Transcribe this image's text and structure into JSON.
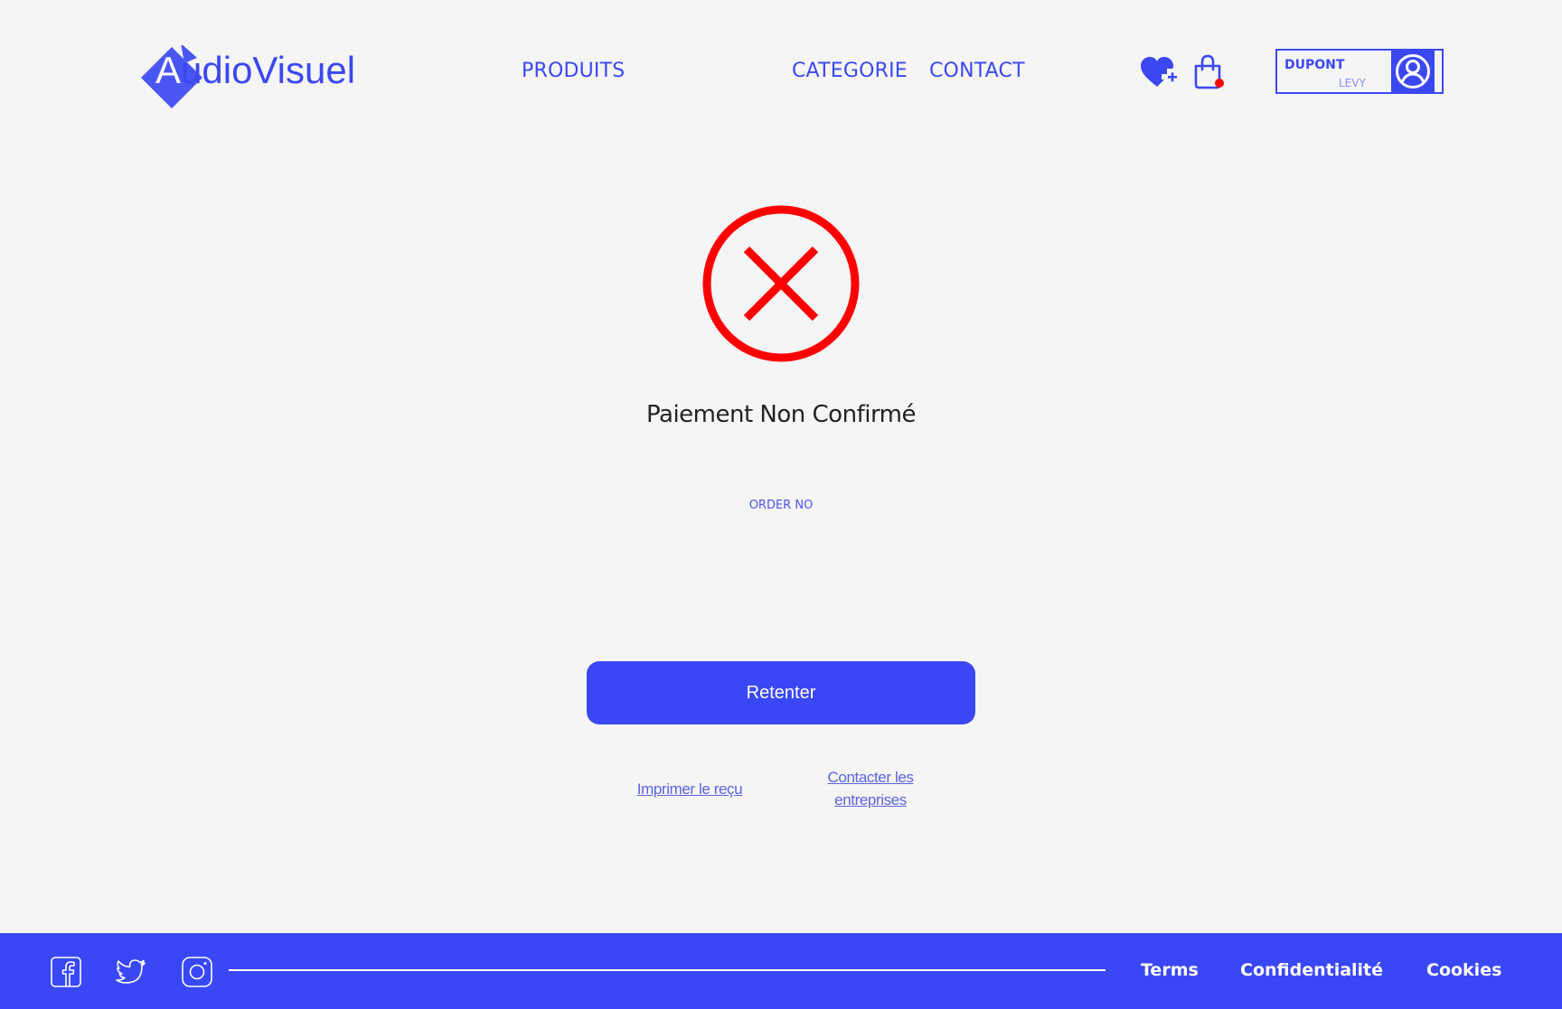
{
  "brand": {
    "logo_first_letter": "A",
    "logo_rest": "udioVisuel",
    "accent_color": "#3b48f2"
  },
  "nav": {
    "items": [
      {
        "label": "PRODUITS"
      },
      {
        "label": "CATEGORIE"
      },
      {
        "label": "CONTACT"
      }
    ]
  },
  "header_icons": {
    "wishlist": "heart-plus-icon",
    "cart": "shopping-bag-icon",
    "cart_badge_color": "#ff0000"
  },
  "user": {
    "first_name": "DUPONT",
    "last_name": "LEVY",
    "avatar_icon": "user-circle-icon"
  },
  "status": {
    "icon": "error-x-circle-icon",
    "icon_color": "#ff0000",
    "title": "Paiement Non Confirmé",
    "order_label": "ORDER NO"
  },
  "actions": {
    "retry_label": "Retenter",
    "print_label": "Imprimer le reçu",
    "contact_label": "Contacter les entreprises"
  },
  "footer": {
    "social": [
      "facebook-icon",
      "twitter-icon",
      "instagram-icon"
    ],
    "links": [
      {
        "label": "Terms"
      },
      {
        "label": "Confidentialité"
      },
      {
        "label": "Cookies"
      }
    ],
    "background_color": "#3a47f5"
  }
}
